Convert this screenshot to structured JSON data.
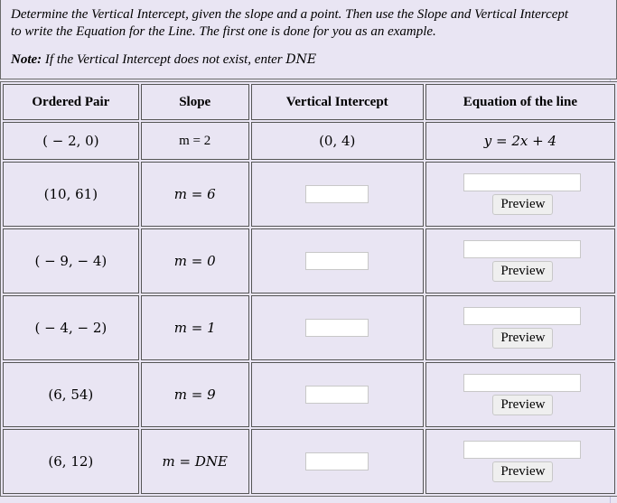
{
  "instructions": {
    "line1": "Determine the Vertical Intercept, given the slope and a point. Then use the Slope and Vertical Intercept",
    "line2": "to write the Equation for the Line. The first one is done for you as an example.",
    "note_label": "Note:",
    "note_text": " If the Vertical Intercept does not exist, enter ",
    "note_dne": "DNE"
  },
  "table": {
    "headers": [
      "Ordered Pair",
      "Slope",
      "Vertical Intercept",
      "Equation of the line"
    ],
    "example": {
      "ordered_pair": "( − 2, 0)",
      "slope": "m = 2",
      "vertical_intercept": "(0, 4)",
      "equation": "y = 2x + 4"
    },
    "rows": [
      {
        "ordered_pair": "(10, 61)",
        "slope": "m = 6",
        "vertical_intercept_value": "",
        "equation_value": "",
        "preview_label": "Preview"
      },
      {
        "ordered_pair": "( − 9,  − 4)",
        "slope": "m = 0",
        "vertical_intercept_value": "",
        "equation_value": "",
        "preview_label": "Preview"
      },
      {
        "ordered_pair": "( − 4,  − 2)",
        "slope": "m = 1",
        "vertical_intercept_value": "",
        "equation_value": "",
        "preview_label": "Preview"
      },
      {
        "ordered_pair": "(6, 54)",
        "slope": "m = 9",
        "vertical_intercept_value": "",
        "equation_value": "",
        "preview_label": "Preview"
      },
      {
        "ordered_pair": "(6, 12)",
        "slope": "m = DNE",
        "vertical_intercept_value": "",
        "equation_value": "",
        "preview_label": "Preview"
      }
    ]
  }
}
